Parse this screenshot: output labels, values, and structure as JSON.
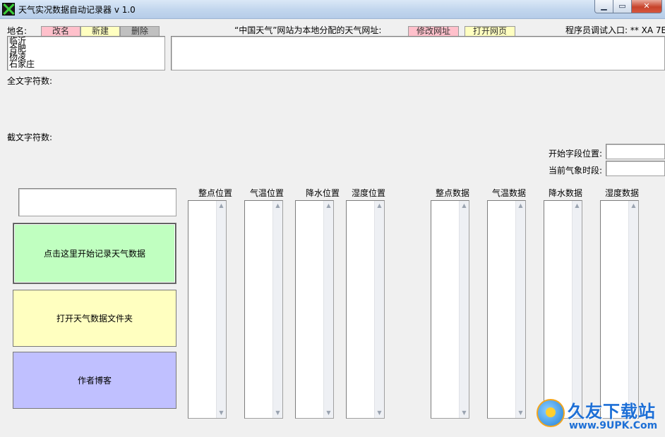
{
  "window": {
    "title": "天气实况数据自动记录器 v 1.0",
    "minimize_glyph": "▁",
    "maximize_glyph": "▭",
    "close_glyph": "✕"
  },
  "location": {
    "label": "地名:",
    "rename_label": "改名",
    "new_label": "新建",
    "delete_label": "删除",
    "cities": [
      "临沂",
      "合肥",
      "杨凌",
      "石家庄"
    ]
  },
  "url_section": {
    "label": "“中国天气”网站为本地分配的天气网址:",
    "edit_label": "修改网址",
    "open_label": "打开网页",
    "url_value": ""
  },
  "debug": {
    "label": "程序员调试入口: ** XA 7E"
  },
  "full_text_count_label": "全文字符数:",
  "cut_text_count_label": "截文字符数:",
  "start_field_label": "开始字段位置:",
  "current_time_label": "当前气象时段:",
  "buttons": {
    "start_record": "点击这里开始记录天气数据",
    "open_folder": "打开天气数据文件夹",
    "author_blog": "作者博客"
  },
  "position_columns": [
    "整点位置",
    "气温位置",
    "降水位置",
    "湿度位置"
  ],
  "data_columns": [
    "整点数据",
    "气温数据",
    "降水数据",
    "湿度数据"
  ],
  "scroll_icons": {
    "up": "▲",
    "down": "▼"
  },
  "watermark": {
    "title": "久友下载站",
    "url": "www.9UPK.Com"
  },
  "colors": {
    "rename_btn": "#ffc0cb",
    "new_btn": "#ffffc0",
    "delete_btn": "#c0c0c0",
    "start_btn": "#c0ffc0",
    "folder_btn": "#ffffc0",
    "blog_btn": "#c0c0ff"
  }
}
